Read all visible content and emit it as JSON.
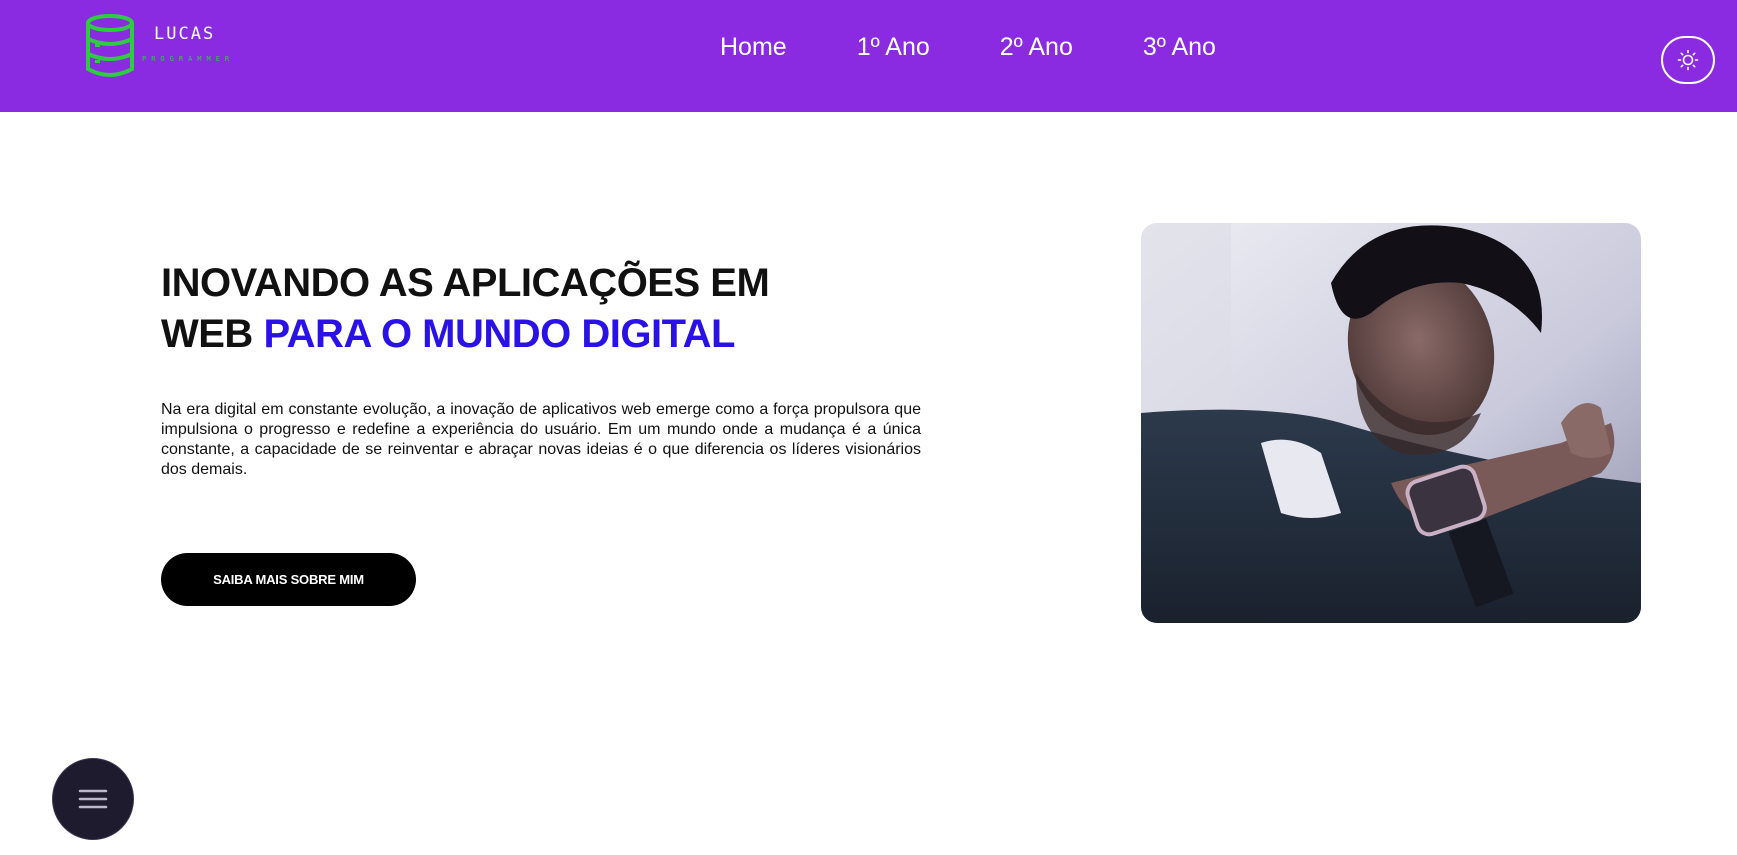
{
  "header": {
    "logo": {
      "title": "LUCAS",
      "subtitle": "PROGRAMMER",
      "icon": "database-icon",
      "icon_color": "#2ecc40"
    },
    "nav": [
      "Home",
      "1º Ano",
      "2º Ano",
      "3º Ano"
    ],
    "theme_toggle_icon": "sun-icon",
    "background": "#8a2be2"
  },
  "hero": {
    "title_line1": "INOVANDO AS APLICAÇÕES EM",
    "title_line2_plain": "WEB",
    "title_line2_accent": "PARA O MUNDO DIGITAL",
    "accent_color": "#2a12e6",
    "paragraph": "Na era digital em constante evolução, a inovação de aplicativos web emerge como a força propulsora que impulsiona o progresso e redefine a experiência do usuário. Em um mundo onde a mudança é a única constante, a capacidade de se reinventar e abraçar novas ideias é o que diferencia os líderes visionários dos demais.",
    "cta_label": "SAIBA MAIS SOBRE MIM"
  },
  "photo": {
    "icon": "profile-photo"
  },
  "fab": {
    "icon": "hamburger-menu-icon"
  }
}
